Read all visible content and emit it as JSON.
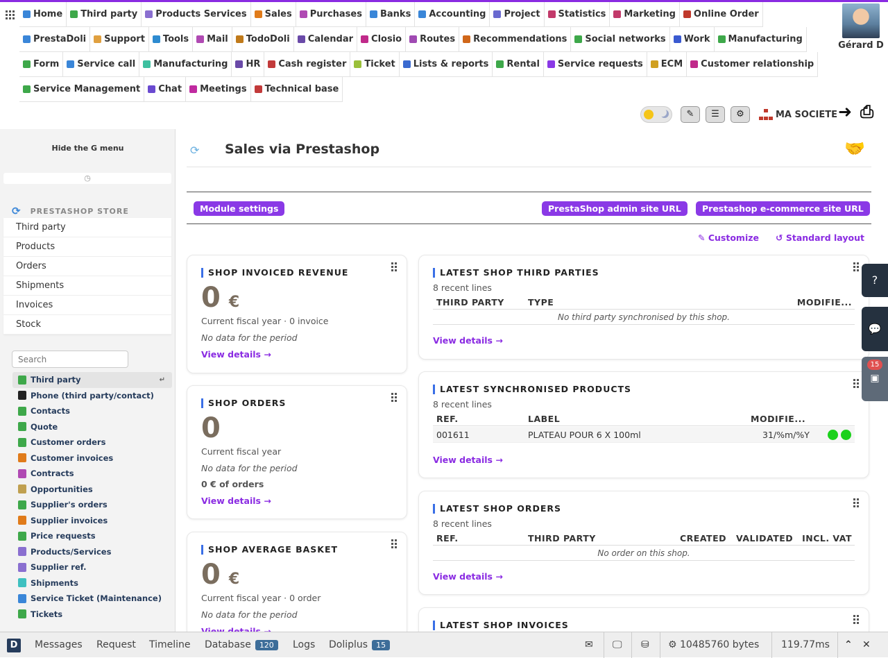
{
  "menu": [
    {
      "label": "Home",
      "color": "#3a86d8"
    },
    {
      "label": "Third party",
      "color": "#3ea84a"
    },
    {
      "label": "Products Services",
      "color": "#8a6fd0"
    },
    {
      "label": "Sales",
      "color": "#e07b1a"
    },
    {
      "label": "Purchases",
      "color": "#b04ab3"
    },
    {
      "label": "Banks",
      "color": "#3a86d8"
    },
    {
      "label": "Accounting",
      "color": "#3a86d8"
    },
    {
      "label": "Project",
      "color": "#6a6ad0"
    },
    {
      "label": "Statistics",
      "color": "#c23a6a"
    },
    {
      "label": "Marketing",
      "color": "#c23a6a"
    },
    {
      "label": "Online Order",
      "color": "#c0392b"
    },
    {
      "label": "PrestaDoli",
      "color": "#3a86d8"
    },
    {
      "label": "Support",
      "color": "#e0a040"
    },
    {
      "label": "Tools",
      "color": "#2e8bd0"
    },
    {
      "label": "Mail",
      "color": "#b04ab3"
    },
    {
      "label": "TodoDoli",
      "color": "#c07a1a"
    },
    {
      "label": "Calendar",
      "color": "#6a4aa8"
    },
    {
      "label": "Closio",
      "color": "#c02a8a"
    },
    {
      "label": "Routes",
      "color": "#a04ab3"
    },
    {
      "label": "Recommendations",
      "color": "#d0671a"
    },
    {
      "label": "Social networks",
      "color": "#3ea84a"
    },
    {
      "label": "Work",
      "color": "#3a5ad0"
    },
    {
      "label": "Manufacturing",
      "color": "#3ea84a"
    },
    {
      "label": "Form",
      "color": "#3ea84a"
    },
    {
      "label": "Service call",
      "color": "#3a86d8"
    },
    {
      "label": "Manufacturing",
      "color": "#3ec0a0"
    },
    {
      "label": "HR",
      "color": "#6a4aa8"
    },
    {
      "label": "Cash register",
      "color": "#c23a3a"
    },
    {
      "label": "Ticket",
      "color": "#9ac03a"
    },
    {
      "label": "Lists & reports",
      "color": "#3a6ad0"
    },
    {
      "label": "Rental",
      "color": "#3ea84a"
    },
    {
      "label": "Service requests",
      "color": "#8a39e6"
    },
    {
      "label": "ECM",
      "color": "#d0a020"
    },
    {
      "label": "Customer relationship",
      "color": "#c02a8a"
    },
    {
      "label": "Service Management",
      "color": "#3ea84a"
    },
    {
      "label": "Chat",
      "color": "#6a4ad0"
    },
    {
      "label": "Meetings",
      "color": "#c02aa0"
    },
    {
      "label": "Technical base",
      "color": "#c23a3a"
    }
  ],
  "user": {
    "name": "Gérard D"
  },
  "company": {
    "name": "MA SOCIETE"
  },
  "left": {
    "hide_g": "Hide the G menu",
    "store_title": "PRESTASHOP STORE",
    "store_menu": [
      "Third party",
      "Products",
      "Orders",
      "Shipments",
      "Invoices",
      "Stock"
    ],
    "search_placeholder": "Search",
    "gmenu": [
      {
        "label": "Third party",
        "color": "#3ea84a"
      },
      {
        "label": "Phone (third party/contact)",
        "color": "#222"
      },
      {
        "label": "Contacts",
        "color": "#3ea84a"
      },
      {
        "label": "Quote",
        "color": "#3ea84a"
      },
      {
        "label": "Customer orders",
        "color": "#3ea84a"
      },
      {
        "label": "Customer invoices",
        "color": "#e07b1a"
      },
      {
        "label": "Contracts",
        "color": "#b04ab3"
      },
      {
        "label": "Opportunities",
        "color": "#c0a050"
      },
      {
        "label": "Supplier's orders",
        "color": "#3ea84a"
      },
      {
        "label": "Supplier invoices",
        "color": "#e07b1a"
      },
      {
        "label": "Price requests",
        "color": "#3ea84a"
      },
      {
        "label": "Products/Services",
        "color": "#8a6fd0"
      },
      {
        "label": "Supplier ref.",
        "color": "#8a6fd0"
      },
      {
        "label": "Shipments",
        "color": "#3ec0c0"
      },
      {
        "label": "Service Ticket (Maintenance)",
        "color": "#3a86d8"
      },
      {
        "label": "Tickets",
        "color": "#3ea84a"
      }
    ]
  },
  "main": {
    "title": "Sales via Prestashop",
    "buttons": {
      "settings": "Module settings",
      "admin": "PrestaShop admin site URL",
      "shop": "Prestashop e-commerce site URL"
    },
    "customize": "Customize",
    "standard": "Standard layout"
  },
  "cards": {
    "revenue": {
      "title": "SHOP INVOICED REVENUE",
      "value": "0",
      "unit": "€",
      "sub": "Current fiscal year · 0 invoice",
      "nodata": "No data for the period",
      "link": "View details →"
    },
    "orders": {
      "title": "SHOP ORDERS",
      "value": "0",
      "sub": "Current fiscal year",
      "nodata": "No data for the period",
      "extra": "0 € of orders",
      "link": "View details →"
    },
    "basket": {
      "title": "SHOP AVERAGE BASKET",
      "value": "0",
      "unit": "€",
      "sub": "Current fiscal year · 0 order",
      "nodata": "No data for the period",
      "link": "View details →"
    },
    "thirdparties": {
      "title": "LATEST SHOP THIRD PARTIES",
      "sub": "8 recent lines",
      "cols": [
        "THIRD PARTY",
        "TYPE",
        "MODIFIE..."
      ],
      "empty": "No third party synchronised by this shop.",
      "link": "View details →"
    },
    "products": {
      "title": "LATEST SYNCHRONISED PRODUCTS",
      "sub": "8 recent lines",
      "cols": [
        "REF.",
        "LABEL",
        "MODIFIE..."
      ],
      "row": {
        "ref": "001611",
        "label": "PLATEAU POUR 6 X 100ml",
        "modified": "31/%m/%Y"
      },
      "link": "View details →"
    },
    "shoporders": {
      "title": "LATEST SHOP ORDERS",
      "sub": "8 recent lines",
      "cols": [
        "REF.",
        "THIRD PARTY",
        "CREATED",
        "VALIDATED",
        "INCL. VAT"
      ],
      "empty": "No order on this shop.",
      "link": "View details →"
    },
    "invoices": {
      "title": "LATEST SHOP INVOICES"
    }
  },
  "right_tabs": {
    "badge": "15"
  },
  "debug": {
    "logo": "D",
    "tabs": [
      "Messages",
      "Request",
      "Timeline",
      "Database",
      "Logs",
      "Doliplus"
    ],
    "db_count": "120",
    "doliplus_count": "15",
    "memory": "10485760 bytes",
    "time": "119.77ms"
  }
}
